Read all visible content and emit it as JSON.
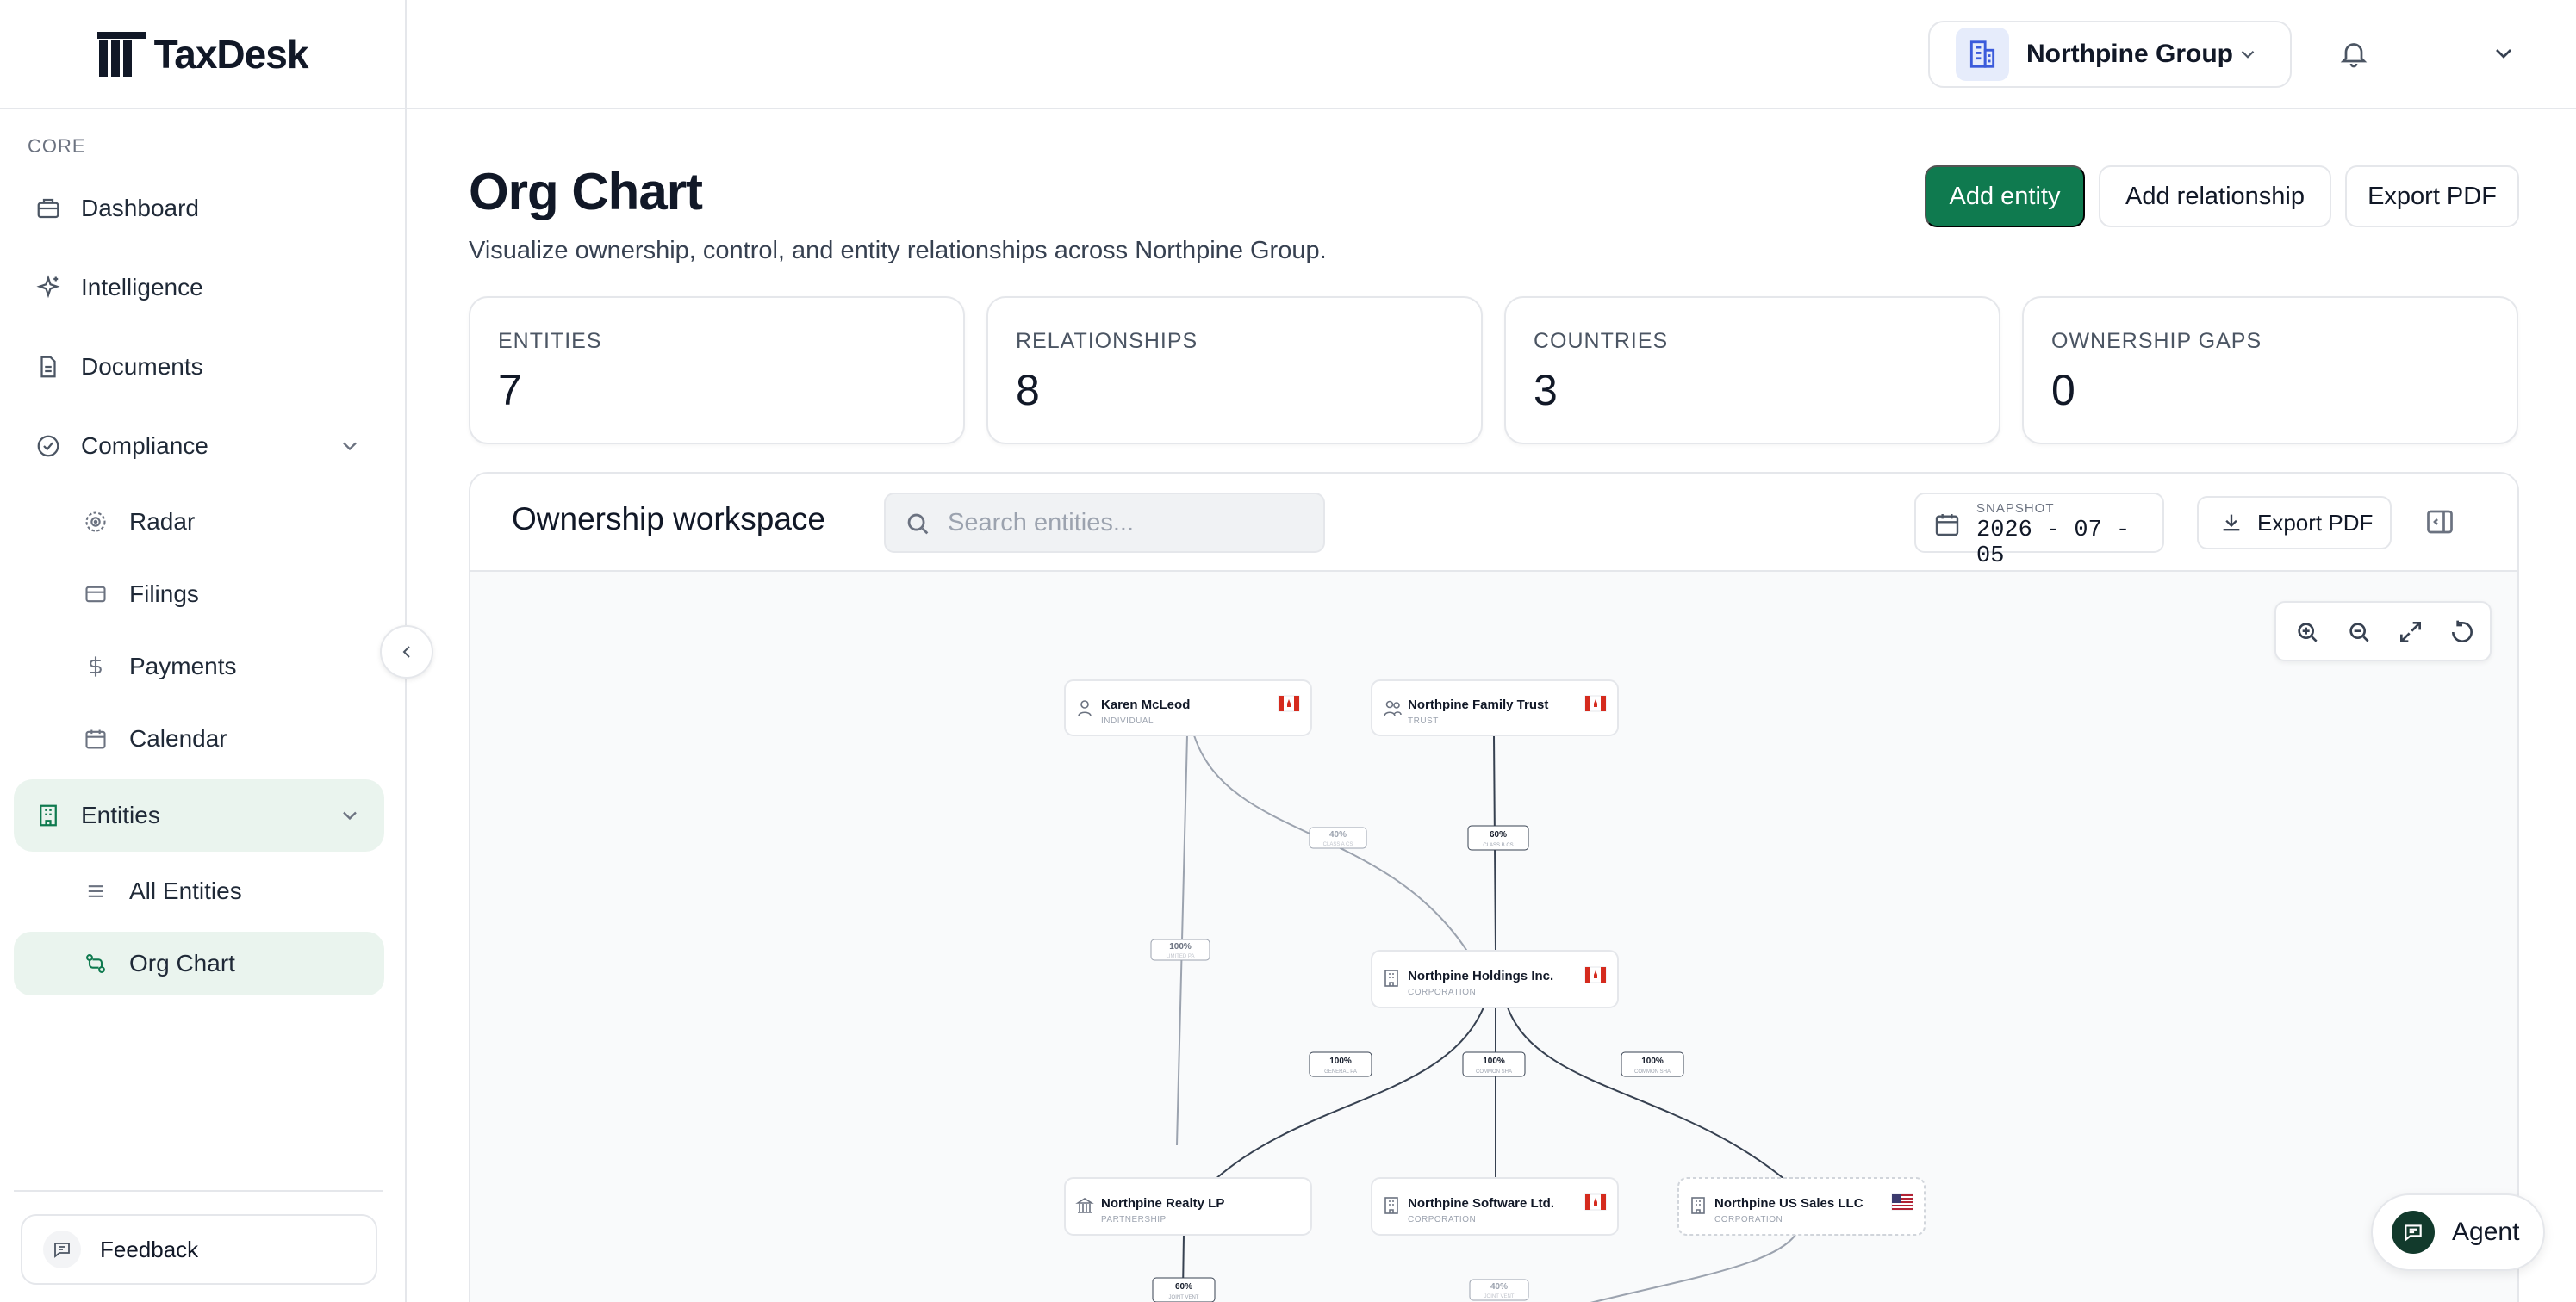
{
  "app": {
    "name": "TaxDesk"
  },
  "sidebar": {
    "section_label": "CORE",
    "items": [
      {
        "label": "Dashboard",
        "icon": "briefcase-icon"
      },
      {
        "label": "Intelligence",
        "icon": "sparkles-icon"
      },
      {
        "label": "Documents",
        "icon": "document-icon"
      },
      {
        "label": "Compliance",
        "icon": "check-circle-icon",
        "expanded": true,
        "children": [
          {
            "label": "Radar",
            "icon": "radar-icon"
          },
          {
            "label": "Filings",
            "icon": "card-icon"
          },
          {
            "label": "Payments",
            "icon": "dollar-icon"
          },
          {
            "label": "Calendar",
            "icon": "calendar-icon"
          }
        ]
      },
      {
        "label": "Entities",
        "icon": "building-icon",
        "expanded": true,
        "active": true,
        "children": [
          {
            "label": "All Entities",
            "icon": "list-icon"
          },
          {
            "label": "Org Chart",
            "icon": "org-chart-icon",
            "active": true
          }
        ]
      }
    ],
    "feedback_label": "Feedback"
  },
  "topbar": {
    "org_name": "Northpine Group"
  },
  "page": {
    "title": "Org Chart",
    "subtitle": "Visualize ownership, control, and entity relationships across Northpine Group.",
    "buttons": {
      "add_entity": "Add entity",
      "add_relationship": "Add relationship",
      "export_pdf": "Export PDF"
    }
  },
  "stats": [
    {
      "label": "ENTITIES",
      "value": "7"
    },
    {
      "label": "RELATIONSHIPS",
      "value": "8"
    },
    {
      "label": "COUNTRIES",
      "value": "3"
    },
    {
      "label": "OWNERSHIP GAPS",
      "value": "0"
    }
  ],
  "workspace": {
    "title": "Ownership workspace",
    "search_placeholder": "Search entities...",
    "snapshot_label": "SNAPSHOT",
    "snapshot_value": "2026 - 07 - 05",
    "export_label": "Export PDF"
  },
  "org_chart": {
    "nodes": [
      {
        "id": "karen",
        "name": "Karen McLeod",
        "type": "INDIVIDUAL",
        "country": "CA"
      },
      {
        "id": "trust",
        "name": "Northpine Family Trust",
        "type": "TRUST",
        "country": "CA"
      },
      {
        "id": "holdings",
        "name": "Northpine Holdings Inc.",
        "type": "CORPORATION",
        "country": "CA"
      },
      {
        "id": "realty",
        "name": "Northpine Realty LP",
        "type": "PARTNERSHIP",
        "country": ""
      },
      {
        "id": "software",
        "name": "Northpine Software Ltd.",
        "type": "CORPORATION",
        "country": "CA"
      },
      {
        "id": "ussales",
        "name": "Northpine US Sales LLC",
        "type": "CORPORATION",
        "country": "US"
      }
    ],
    "edges": [
      {
        "from": "karen",
        "to": "holdings",
        "pct": "40%",
        "kind": "CLASS A CS"
      },
      {
        "from": "trust",
        "to": "holdings",
        "pct": "60%",
        "kind": "CLASS B CS"
      },
      {
        "from": "karen",
        "to": "realty",
        "pct": "100%",
        "kind": "LIMITED PA"
      },
      {
        "from": "holdings",
        "to": "realty",
        "pct": "100%",
        "kind": "GENERAL PA"
      },
      {
        "from": "holdings",
        "to": "software",
        "pct": "100%",
        "kind": "COMMON SHA"
      },
      {
        "from": "holdings",
        "to": "ussales",
        "pct": "100%",
        "kind": "COMMON SHA"
      },
      {
        "from": "realty",
        "to": "jv",
        "pct": "60%",
        "kind": "JOINT VENT"
      },
      {
        "from": "ussales",
        "to": "jv",
        "pct": "40%",
        "kind": "JOINT VENT"
      }
    ]
  },
  "agent": {
    "label": "Agent"
  },
  "colors": {
    "accent": "#0f7a4f",
    "active_bg": "#eaf4ee",
    "border": "#e5e7eb"
  }
}
